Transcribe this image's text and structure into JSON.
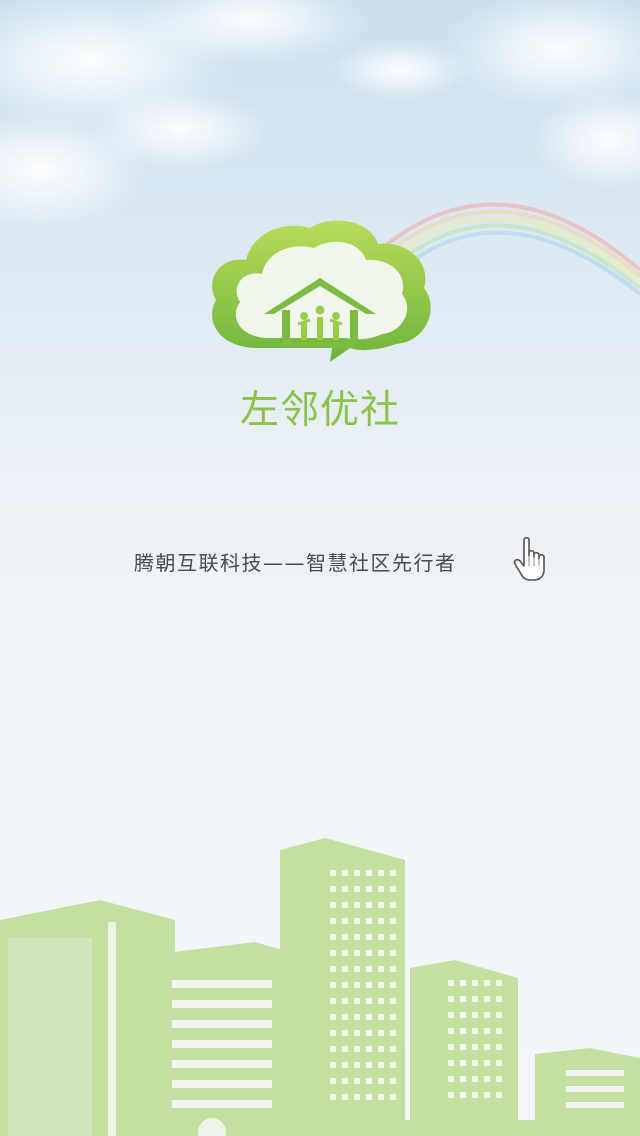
{
  "splash": {
    "app_name": "左邻优社",
    "slogan": "腾朝互联科技——智慧社区先行者",
    "logo_icon": "cloud-house-icon",
    "tap_icon": "pointing-hand-icon",
    "skyline_icon": "city-skyline-icon"
  },
  "colors": {
    "brand_green": "#8bc34a",
    "light_green": "#c3e0a0",
    "sky_blue": "#c9dfef",
    "text_gray": "#4a4a4a"
  }
}
